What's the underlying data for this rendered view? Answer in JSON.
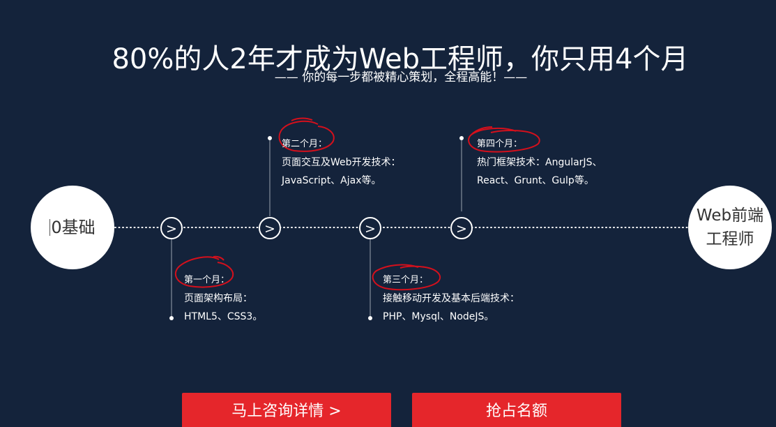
{
  "header": {
    "title": "80%的人2年才成为Web工程师，你只用4个月",
    "subtitle": "—— 你的每一步都被精心策划，全程高能！——"
  },
  "timeline": {
    "start_label": "0基础",
    "end_label_line1": "Web前端",
    "end_label_line2": "工程师",
    "arrow_glyph": ">",
    "milestones": [
      {
        "month": "第一个月：",
        "topic": "页面架构布局：",
        "tech": "HTML5、CSS3。"
      },
      {
        "month": "第二个月：",
        "topic": "页面交互及Web开发技术：",
        "tech": "JavaScript、Ajax等。"
      },
      {
        "month": "第三个月：",
        "topic": "接触移动开发及基本后端技术：",
        "tech": "PHP、Mysql、NodeJS。"
      },
      {
        "month": "第四个月：",
        "topic": "热门框架技术：AngularJS、",
        "tech": "React、Grunt、Gulp等。"
      }
    ]
  },
  "actions": {
    "consult_label": "马上咨询详情 >",
    "enroll_label": "抢占名额"
  },
  "colors": {
    "background": "#14233b",
    "accent_red": "#e5262b",
    "annotation_red": "#d4101c",
    "text": "#ffffff"
  }
}
